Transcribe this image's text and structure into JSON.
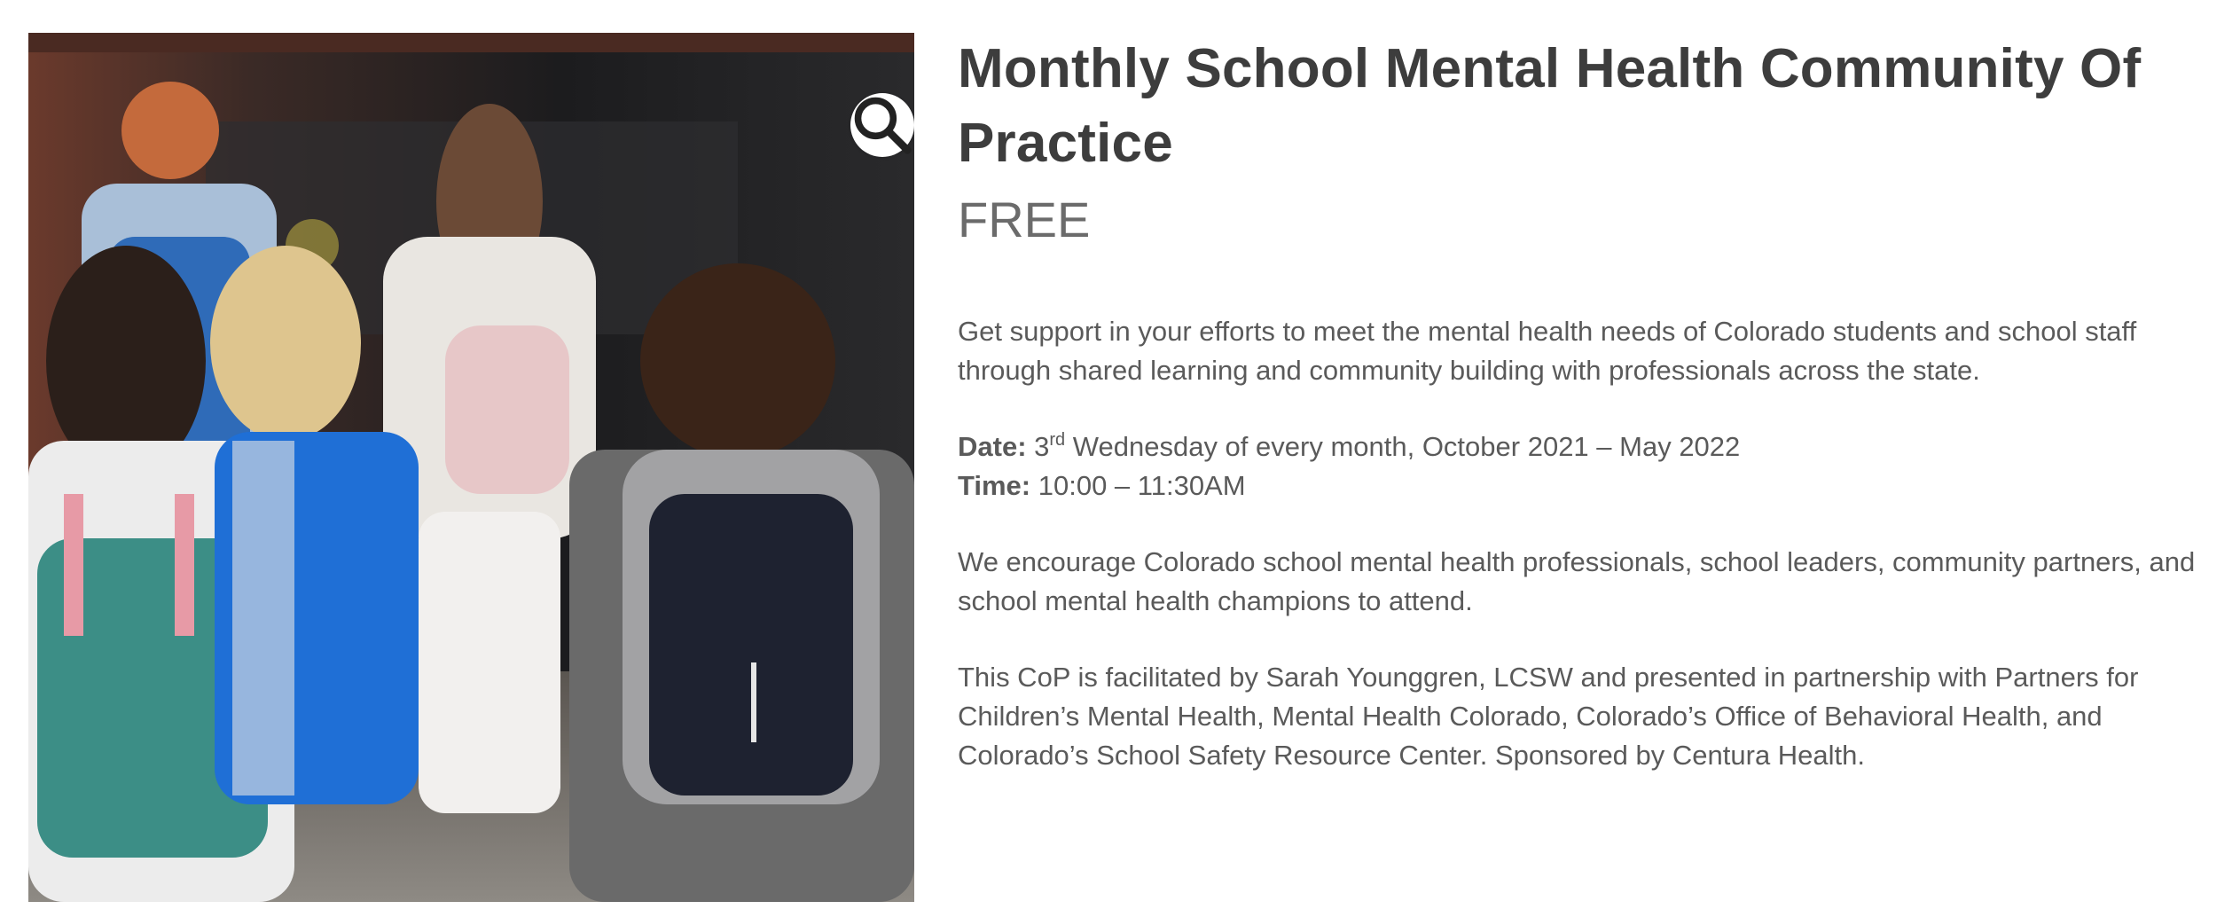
{
  "product": {
    "title": "Monthly School Mental Health Community Of Practice",
    "price": "FREE",
    "intro": "Get support in your efforts to meet the mental health needs of Colorado students and school staff through shared learning and community building with professionals across the state.",
    "date_label": "Date:",
    "date_num": "3",
    "date_suffix": "rd",
    "date_rest": " Wednesday of every month, October 2021 – May 2022",
    "time_label": "Time:",
    "time_value": " 10:00 – 11:30AM",
    "encourage": "We encourage Colorado school mental health professionals, school leaders, community partners, and school mental health champions to attend.",
    "facilitation": "This CoP is facilitated by Sarah Younggren, LCSW and presented in partnership with Partners for Children’s Mental Health, Mental Health Colorado, Colorado’s Office of Behavioral Health, and Colorado’s School Safety Resource Center. Sponsored by Centura Health."
  },
  "gallery": {
    "zoom_icon": "magnifier-icon"
  },
  "colors": {
    "title": "#3d3d3d",
    "text": "#5a5a5a",
    "price": "#6b6b6b"
  }
}
